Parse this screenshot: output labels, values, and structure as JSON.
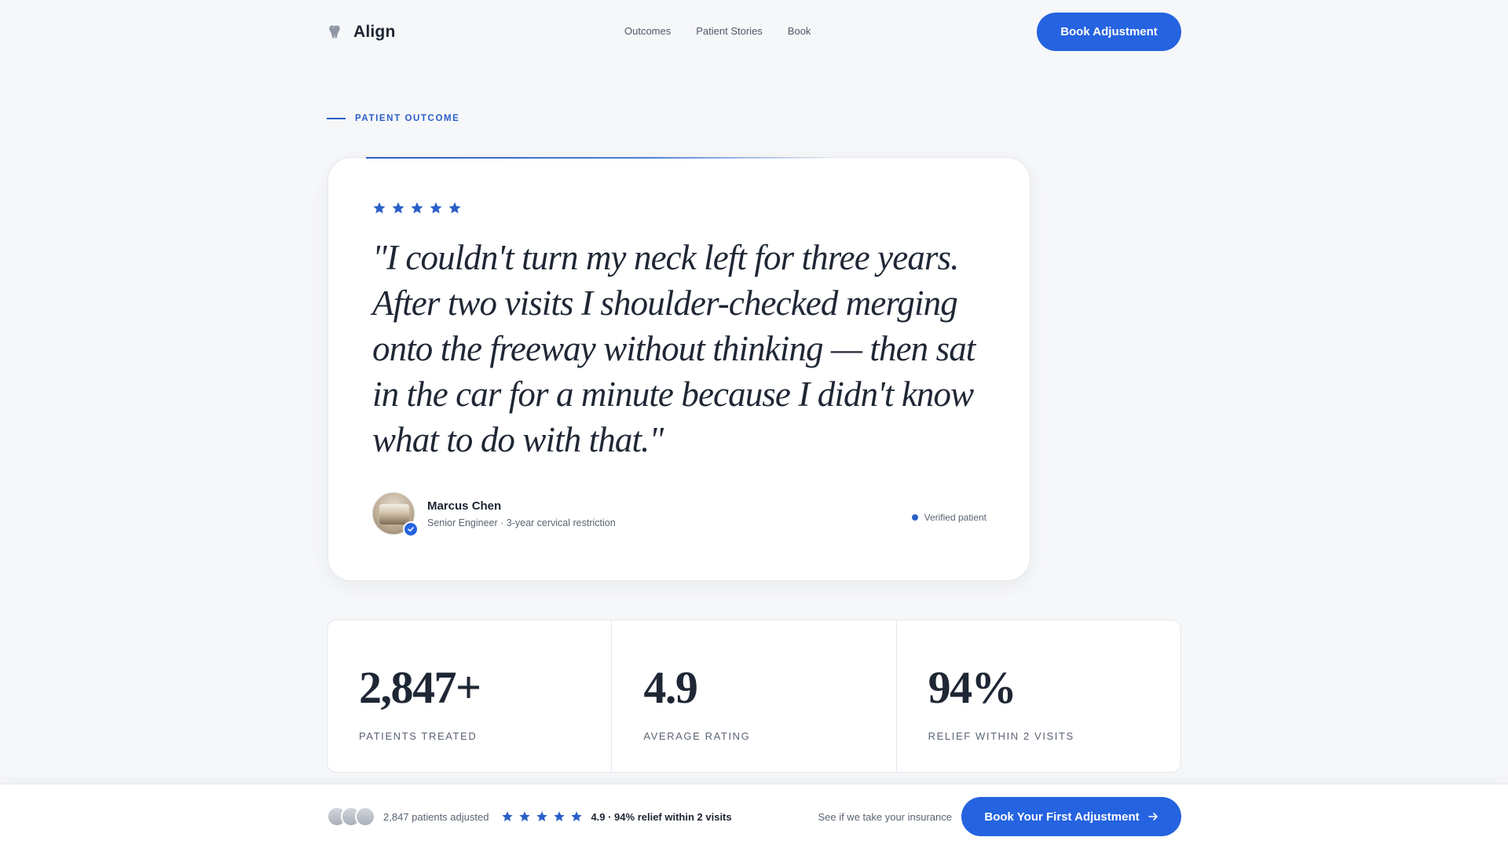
{
  "brand": {
    "name": "Align",
    "icon": "tooth-icon"
  },
  "nav": {
    "links": [
      "Outcomes",
      "Patient Stories",
      "Book"
    ],
    "cta": "Book Adjustment"
  },
  "eyebrow": "PATIENT OUTCOME",
  "testimonial": {
    "rating": 5,
    "quote": "\"I couldn't turn my neck left for three years. After two visits I shoulder-checked merging onto the freeway without thinking — then sat in the car for a minute because I didn't know what to do with that.\"",
    "author": {
      "name": "Marcus Chen",
      "meta": "Senior Engineer · 3-year cervical restriction"
    },
    "verified_label": "Verified patient"
  },
  "stats": [
    {
      "value": "2,847+",
      "label": "PATIENTS TREATED"
    },
    {
      "value": "4.9",
      "label": "AVERAGE RATING"
    },
    {
      "value": "94%",
      "label": "RELIEF WITHIN 2 VISITS"
    }
  ],
  "bottom_bar": {
    "patients_text": "2,847 patients adjusted",
    "rating_text": "4.9 · 94% relief within 2 visits",
    "insurance_link": "See if we take your insurance",
    "cta": "Book Your First Adjustment"
  },
  "colors": {
    "accent": "#2563e0",
    "text_dark": "#1c2431",
    "text_muted": "#5a6473",
    "background": "#f6f7f9"
  }
}
